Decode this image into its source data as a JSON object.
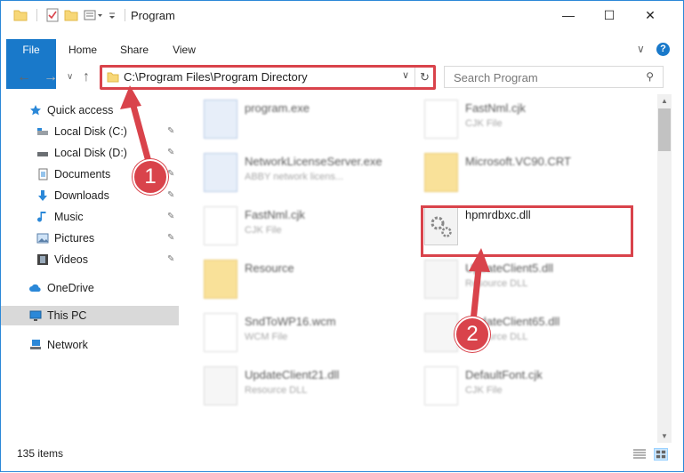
{
  "window": {
    "title": "Program",
    "minimize_glyph": "—",
    "maximize_glyph": "☐",
    "close_glyph": "✕"
  },
  "ribbon": {
    "tabs": [
      "File",
      "Home",
      "Share",
      "View"
    ],
    "expand_glyph": "∨",
    "help_glyph": "?"
  },
  "address": {
    "path": "C:\\Program Files\\Program Directory",
    "dropdown_glyph": "∨",
    "refresh_glyph": "↻"
  },
  "search": {
    "placeholder": "Search Program",
    "icon_glyph": "⚲"
  },
  "nav": {
    "back_glyph": "←",
    "forward_glyph": "→",
    "recent_glyph": "∨",
    "up_glyph": "↑",
    "items": [
      {
        "label": "Quick access",
        "icon": "star-icon",
        "pinned": false
      },
      {
        "label": "Local Disk (C:)",
        "icon": "drive-icon",
        "pinned": true
      },
      {
        "label": "Local Disk (D:)",
        "icon": "drive-icon",
        "pinned": true
      },
      {
        "label": "Documents",
        "icon": "documents-icon",
        "pinned": true
      },
      {
        "label": "Downloads",
        "icon": "download-icon",
        "pinned": true
      },
      {
        "label": "Music",
        "icon": "music-icon",
        "pinned": true
      },
      {
        "label": "Pictures",
        "icon": "pictures-icon",
        "pinned": true
      },
      {
        "label": "Videos",
        "icon": "videos-icon",
        "pinned": true
      },
      {
        "label": "OneDrive",
        "icon": "cloud-icon",
        "pinned": false
      },
      {
        "label": "This PC",
        "icon": "computer-icon",
        "pinned": false
      },
      {
        "label": "Network",
        "icon": "network-icon",
        "pinned": false
      }
    ],
    "pin_glyph": "📌"
  },
  "files": [
    {
      "name": "program.exe",
      "sub": "",
      "kind": "app"
    },
    {
      "name": "FastNml.cjk",
      "sub": "CJK File",
      "kind": "doc"
    },
    {
      "name": "NetworkLicenseServer.exe",
      "sub": "ABBY network licens...",
      "kind": "app"
    },
    {
      "name": "Microsoft.VC90.CRT",
      "sub": "",
      "kind": "folder"
    },
    {
      "name": "FastNml.cjk",
      "sub": "CJK File",
      "kind": "doc"
    },
    {
      "name": "hpmrdbxc.dll",
      "sub": "",
      "kind": "gear"
    },
    {
      "name": "Resource",
      "sub": "",
      "kind": "folder"
    },
    {
      "name": "UpdateClient5.dll",
      "sub": "Resource DLL",
      "kind": "gear"
    },
    {
      "name": "SndToWP16.wcm",
      "sub": "WCM File",
      "kind": "doc"
    },
    {
      "name": "UpdateClient65.dll",
      "sub": "Resource DLL",
      "kind": "gear"
    },
    {
      "name": "UpdateClient21.dll",
      "sub": "Resource DLL",
      "kind": "gear"
    },
    {
      "name": "DefaultFont.cjk",
      "sub": "CJK File",
      "kind": "doc"
    }
  ],
  "status": {
    "item_count": "135 items"
  },
  "callouts": [
    "1",
    "2"
  ],
  "colors": {
    "accent": "#1979ca",
    "highlight_red": "#d9434b",
    "selection": "#cce8ff"
  }
}
